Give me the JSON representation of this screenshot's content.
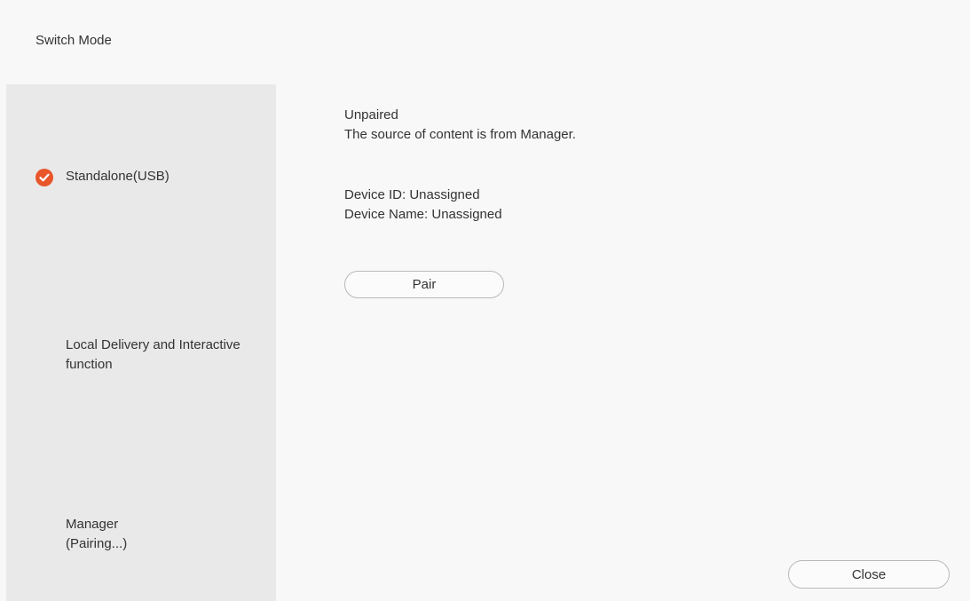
{
  "dialog": {
    "title": "Switch Mode"
  },
  "modes": [
    {
      "label": "Standalone(USB)",
      "selected": true,
      "icon": "check-circle-icon"
    },
    {
      "label": "Local Delivery and Interactive\nfunction",
      "selected": false
    },
    {
      "label": "Manager\n(Pairing...)",
      "selected": false
    }
  ],
  "status": {
    "pairing_state": "Unpaired",
    "description": "The source of content is from Manager."
  },
  "device": {
    "id_line": "Device ID: Unassigned",
    "name_line": "Device Name: Unassigned"
  },
  "buttons": {
    "pair_label": "Pair",
    "close_label": "Close"
  },
  "colors": {
    "accent": "#e8562a",
    "sidebar_bg": "#e9e9e9",
    "page_bg": "#f8f8f8"
  }
}
